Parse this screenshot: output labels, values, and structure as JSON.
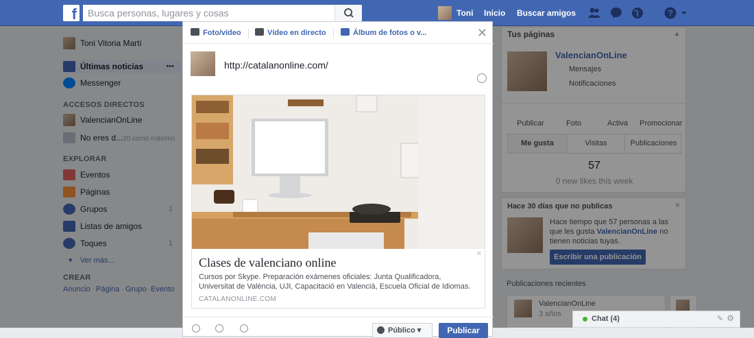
{
  "topbar": {
    "search_placeholder": "Busca personas, lugares y cosas",
    "user_name": "Toni",
    "home": "Inicio",
    "find_friends": "Buscar amigos"
  },
  "left_nav": {
    "profile": "Toni Vitoria Martí",
    "news_feed": "Últimas noticias",
    "news_feed_more": "•••",
    "messenger": "Messenger",
    "shortcuts_heading": "ACCESOS DIRECTOS",
    "shortcut_page": "ValencianOnLine",
    "shortcut_game": "No eres d...",
    "shortcut_game_count": "20 como máximo",
    "explore_heading": "EXPLORAR",
    "explore": [
      {
        "label": "Eventos",
        "count": ""
      },
      {
        "label": "Páginas",
        "count": ""
      },
      {
        "label": "Grupos",
        "count": "1"
      },
      {
        "label": "Listas de amigos",
        "count": ""
      },
      {
        "label": "Toques",
        "count": "1"
      }
    ],
    "see_more": "Ver más...",
    "create_heading": "CREAR",
    "create_links": [
      "Anuncio",
      "Página",
      "Grupo",
      "Evento"
    ]
  },
  "right_col": {
    "pages_heading": "Tus páginas",
    "page_name": "ValencianOnLine",
    "messages": "Mensajes",
    "notifications": "Notificaciones",
    "actions": [
      "Publicar",
      "Foto",
      "Activa",
      "Promocionar"
    ],
    "tabs": [
      "Me gusta",
      "Visitas",
      "Publicaciones"
    ],
    "likes_count": "57",
    "likes_week": "0 new likes this week",
    "inactive_heading": "Hace 30 días que no publicas",
    "inactive_text_1": "Hace tiempo que 57 personas a las que les gusta ",
    "inactive_page": "ValencianOnLine",
    "inactive_text_2": " no tienen noticias tuyas.",
    "write_post": "Escribir una publicación",
    "recent_heading": "Publicaciones recientes",
    "recent_page": "ValencianOnLine",
    "recent_time": "3 años",
    "chat": "Chat (4)"
  },
  "composer": {
    "tab_photo": "Foto/vídeo",
    "tab_live": "Vídeo en directo",
    "tab_album": "Álbum de fotos o v...",
    "text": "http://catalanonline.com/",
    "preview_title": "Clases de valenciano online",
    "preview_desc": "Cursos por Skype. Preparación exámenes oficiales: Junta Qualificadora, Universitat de València, UJI, Capacitació en Valencià, Escuela Oficial de Idiomas.",
    "preview_url": "CATALANONLINE.COM",
    "audience": "Público",
    "publish": "Publicar"
  }
}
